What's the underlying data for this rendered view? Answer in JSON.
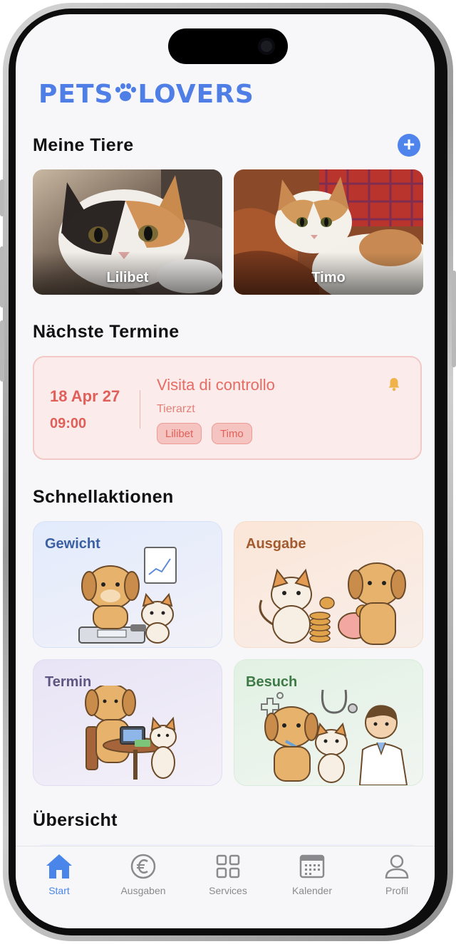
{
  "app": {
    "logo_left": "PETS",
    "logo_right": "LOVERS"
  },
  "pets_section": {
    "title": "Meine Tiere",
    "pets": [
      {
        "name": "Lilibet"
      },
      {
        "name": "Timo"
      }
    ]
  },
  "appointments_section": {
    "title": "Nächste Termine",
    "next": {
      "date": "18 Apr 27",
      "time": "09:00",
      "title": "Visita di controllo",
      "category": "Tierarzt",
      "tags": [
        "Lilibet",
        "Timo"
      ]
    }
  },
  "quick_actions_section": {
    "title": "Schnellaktionen",
    "actions": [
      {
        "label": "Gewicht",
        "color": "#3b5fa3"
      },
      {
        "label": "Ausgabe",
        "color": "#a25a2e"
      },
      {
        "label": "Termin",
        "color": "#5e5682"
      },
      {
        "label": "Besuch",
        "color": "#3e7a45"
      }
    ]
  },
  "overview_section": {
    "title": "Übersicht"
  },
  "tabbar": {
    "tabs": [
      {
        "label": "Start",
        "icon": "home-icon",
        "active": true
      },
      {
        "label": "Ausgaben",
        "icon": "euro-icon",
        "active": false
      },
      {
        "label": "Services",
        "icon": "grid-icon",
        "active": false
      },
      {
        "label": "Kalender",
        "icon": "calendar-icon",
        "active": false
      },
      {
        "label": "Profil",
        "icon": "person-icon",
        "active": false
      }
    ]
  },
  "colors": {
    "accent": "#4a86ea",
    "appointment": "#e15f59"
  }
}
